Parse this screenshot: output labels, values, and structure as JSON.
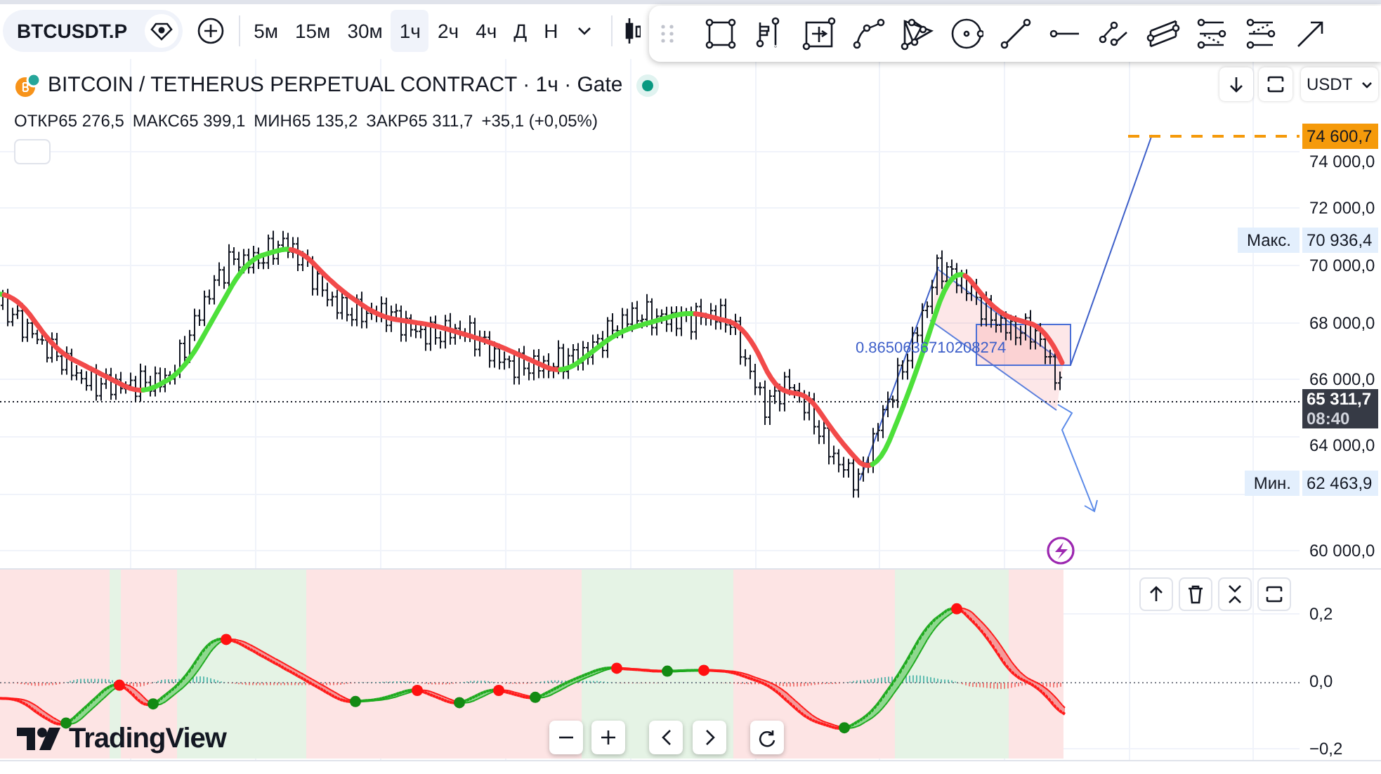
{
  "toolbar": {
    "symbol": "BTCUSDT.P",
    "intervals": [
      {
        "label": "5м",
        "selected": false
      },
      {
        "label": "15м",
        "selected": false
      },
      {
        "label": "30м",
        "selected": false
      },
      {
        "label": "1ч",
        "selected": true
      },
      {
        "label": "2ч",
        "selected": false
      },
      {
        "label": "4ч",
        "selected": false
      },
      {
        "label": "Д",
        "selected": false
      },
      {
        "label": "Н",
        "selected": false
      }
    ]
  },
  "legend": {
    "title": "BITCOIN / TETHERUS PERPETUAL CONTRACT · 1ч · Gate",
    "ohlc": [
      {
        "label": "ОТКР",
        "value": "65 276,5"
      },
      {
        "label": "МАКС",
        "value": "65 399,1"
      },
      {
        "label": "МИН",
        "value": "65 135,2"
      },
      {
        "label": "ЗАКР",
        "value": "65 311,7"
      }
    ],
    "change": "+35,1 (+0,05%)"
  },
  "currency": "USDT",
  "drawing_label": "0.8650636710208274",
  "price_axis": [
    "74 000,0",
    "72 000,0",
    "70 000,0",
    "68 000,0",
    "66 000,0",
    "64 000,0",
    "60 000,0"
  ],
  "price_labels": [
    {
      "kind": "target",
      "value": "74 600,7"
    },
    {
      "kind": "high",
      "label": "Макс.",
      "value": "70 936,4"
    },
    {
      "kind": "last",
      "value": "65 311,7",
      "countdown": "08:40"
    },
    {
      "kind": "low",
      "label": "Мин.",
      "value": "62 463,9"
    }
  ],
  "indicator_axis": [
    "0,2",
    "0,0",
    "−0,2"
  ],
  "logo": "TradingView"
}
